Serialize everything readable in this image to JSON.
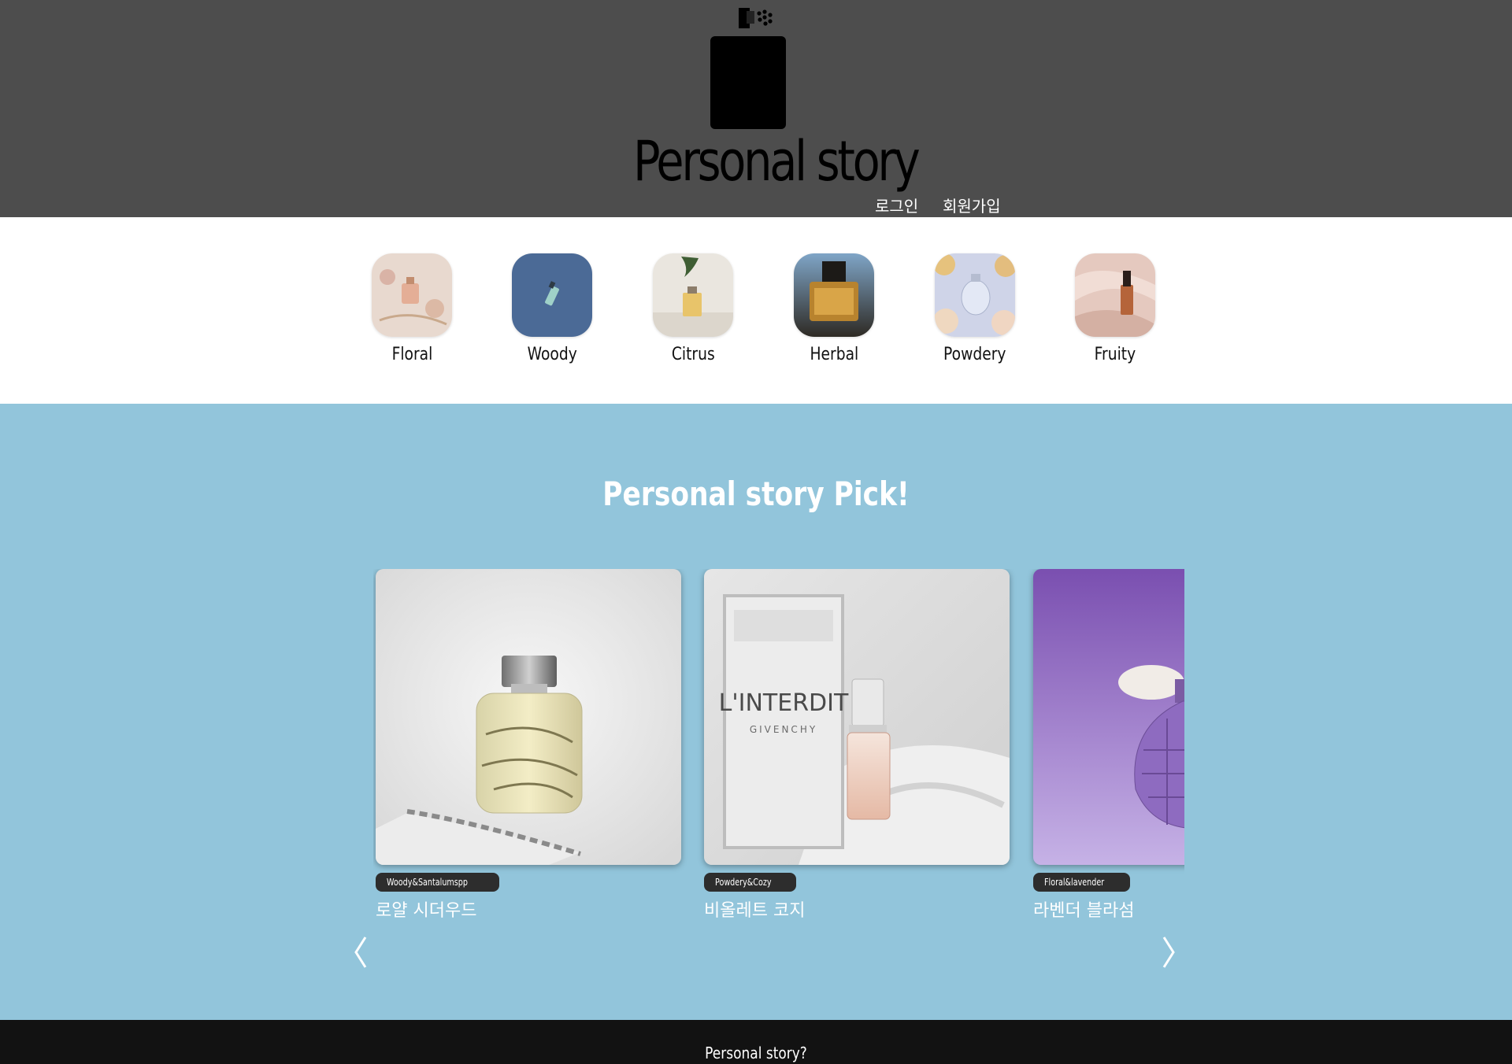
{
  "header": {
    "brand": "Personal story",
    "login_label": "로그인",
    "signup_label": "회원가입",
    "logo_icon": "perfume-bottle-icon"
  },
  "categories": [
    {
      "label": "Floral",
      "image": "floral-perfume-image"
    },
    {
      "label": "Woody",
      "image": "woody-perfume-image"
    },
    {
      "label": "Citrus",
      "image": "citrus-perfume-image"
    },
    {
      "label": "Herbal",
      "image": "herbal-perfume-image"
    },
    {
      "label": "Powdery",
      "image": "powdery-perfume-image"
    },
    {
      "label": "Fruity",
      "image": "fruity-perfume-image"
    }
  ],
  "pick": {
    "title": "Personal story Pick!",
    "cards": [
      {
        "tag": "Woody&Santalumspp",
        "title": "로얄 시더우드",
        "image": "clear-glass-perfume-bottle-image"
      },
      {
        "tag": "Powdery&Cozy",
        "title": "비올레트 코지",
        "image": "givenchy-linterdit-perfume-image",
        "image_text": "L'INTERDIT",
        "image_subtext": "GIVENCHY"
      },
      {
        "tag": "Floral&lavender",
        "title": "라벤더 블라섬",
        "image": "purple-atomizer-bottle-image"
      }
    ],
    "prev_icon": "chevron-left-icon",
    "next_icon": "chevron-right-icon"
  },
  "footer": {
    "text": "Personal story?"
  },
  "colors": {
    "header_bg": "#4d4d4d",
    "pick_bg": "#92c5db",
    "footer_bg": "#121212",
    "tag_bg": "#2d2d2d"
  }
}
